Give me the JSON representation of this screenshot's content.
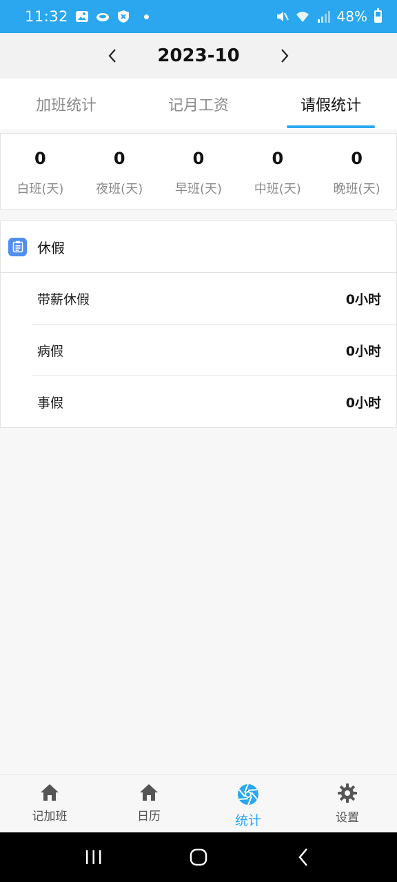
{
  "status_bar": {
    "time": "11:32",
    "battery": "48%",
    "color": "#2aa7ef"
  },
  "header": {
    "month": "2023-10",
    "prev_icon": "chevron-left-icon",
    "next_icon": "chevron-right-icon"
  },
  "tabs": [
    {
      "label": "加班统计",
      "active": false
    },
    {
      "label": "记月工资",
      "active": false
    },
    {
      "label": "请假统计",
      "active": true
    }
  ],
  "summary": [
    {
      "value": "0",
      "label": "白班(天)"
    },
    {
      "value": "0",
      "label": "夜班(天)"
    },
    {
      "value": "0",
      "label": "早班(天)"
    },
    {
      "value": "0",
      "label": "中班(天)"
    },
    {
      "value": "0",
      "label": "晚班(天)"
    }
  ],
  "leave": {
    "title": "休假",
    "icon": "clipboard-icon",
    "rows": [
      {
        "name": "带薪休假",
        "value": "0小时"
      },
      {
        "name": "病假",
        "value": "0小时"
      },
      {
        "name": "事假",
        "value": "0小时"
      }
    ]
  },
  "bottom_nav": [
    {
      "label": "记加班",
      "icon": "home-icon",
      "active": false
    },
    {
      "label": "日历",
      "icon": "home-icon",
      "active": false
    },
    {
      "label": "统计",
      "icon": "aperture-icon",
      "active": true
    },
    {
      "label": "设置",
      "icon": "gear-icon",
      "active": false
    }
  ],
  "colors": {
    "accent": "#2aa7ef",
    "clip_icon": "#4f8ff0"
  }
}
